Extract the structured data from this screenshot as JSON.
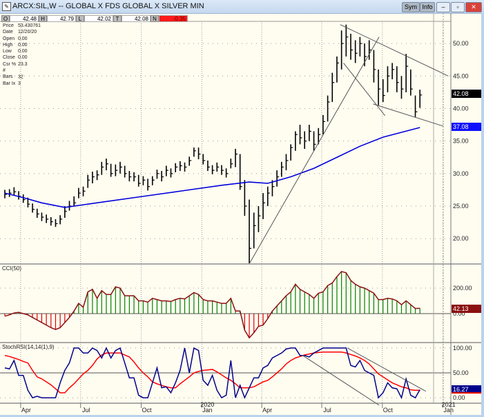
{
  "window": {
    "title": "ARCX:SIL,W -- GLOBAL X FDS GLOBAL X SILVER MIN",
    "buttons": {
      "sym": "Sym",
      "info": "Info",
      "minimize": "–",
      "maximize": "▫",
      "close": "✕"
    }
  },
  "ohlc_strip": {
    "o_label": "O",
    "o_value": "42.48",
    "h_label": "H",
    "h_value": "42.79",
    "l_label": "L",
    "l_value": "42.02",
    "t_label": "T",
    "t_value": "42.08",
    "n_label": "N",
    "n_value": "-0.35"
  },
  "info_box": [
    {
      "label": "Price",
      "value": "53.430761"
    },
    {
      "label": "Date",
      "value": "12/20/20"
    },
    {
      "label": "Open",
      "value": "0.00"
    },
    {
      "label": "High",
      "value": "0.00"
    },
    {
      "label": "Low",
      "value": "0.00"
    },
    {
      "label": "Close",
      "value": "0.00"
    },
    {
      "label": "Csr %",
      "value": "23.3"
    },
    {
      "label": "# Bars",
      "value": "32"
    },
    {
      "label": "Bar Ix",
      "value": "3"
    }
  ],
  "value_tags": {
    "last_price": "42.08",
    "ma_value": "37.08",
    "cci_value": "42.13",
    "stoch_value": "16.27"
  },
  "colors": {
    "background": "#fffcf0",
    "bars": "#000000",
    "moving_average": "#0000dd",
    "cci_positive": "#008000",
    "cci_negative": "#e00000",
    "cci_line": "#8b1010",
    "stoch_k": "#00008b",
    "stoch_d": "#ff0000",
    "trendline": "#555555",
    "change_negative": "#ff1a1a"
  },
  "chart_data": [
    {
      "type": "ohlc",
      "panel": "price",
      "ylim": [
        16.1,
        53.4
      ],
      "y_ticks": [
        "20.00",
        "25.00",
        "30.00",
        "35.00",
        "40.00",
        "45.00",
        "50.00"
      ],
      "grid": true,
      "bars_columns": [
        "date",
        "high",
        "low",
        "close"
      ],
      "bars": [
        [
          "2019-03-08",
          27.5,
          26.2,
          26.8
        ],
        [
          "2019-03-15",
          27.6,
          26.4,
          27
        ],
        [
          "2019-03-22",
          27.9,
          26.6,
          27.2
        ],
        [
          "2019-03-29",
          27.3,
          26,
          26.5
        ],
        [
          "2019-04-05",
          26.8,
          25.5,
          26
        ],
        [
          "2019-04-12",
          26.3,
          24.8,
          25.3
        ],
        [
          "2019-04-19",
          25.4,
          24,
          24.5
        ],
        [
          "2019-04-26",
          24.6,
          23.2,
          23.8
        ],
        [
          "2019-05-03",
          24,
          22.7,
          23.3
        ],
        [
          "2019-05-10",
          23.7,
          22.4,
          23
        ],
        [
          "2019-05-17",
          23.3,
          22,
          22.6
        ],
        [
          "2019-05-24",
          23,
          21.8,
          22.3
        ],
        [
          "2019-05-31",
          23.6,
          22.2,
          23
        ],
        [
          "2019-06-07",
          25,
          23.2,
          24.2
        ],
        [
          "2019-06-14",
          25.8,
          24.3,
          25
        ],
        [
          "2019-06-21",
          26.5,
          25,
          25.5
        ],
        [
          "2019-06-28",
          27.8,
          26.2,
          27
        ],
        [
          "2019-07-05",
          28,
          26.5,
          27.3
        ],
        [
          "2019-07-12",
          29.8,
          27.8,
          29
        ],
        [
          "2019-07-19",
          30.3,
          28.5,
          29.5
        ],
        [
          "2019-07-26",
          30.5,
          29,
          29.8
        ],
        [
          "2019-08-02",
          31.8,
          29.8,
          31
        ],
        [
          "2019-08-09",
          32.3,
          30.5,
          31.5
        ],
        [
          "2019-08-16",
          31.5,
          29.5,
          30
        ],
        [
          "2019-08-23",
          31.4,
          29.6,
          30.5
        ],
        [
          "2019-08-30",
          31.8,
          30,
          31
        ],
        [
          "2019-09-06",
          31.2,
          29.4,
          30
        ],
        [
          "2019-09-13",
          30.4,
          28.8,
          29.5
        ],
        [
          "2019-09-20",
          30.2,
          28.8,
          29.5
        ],
        [
          "2019-09-27",
          29.8,
          28,
          28.5
        ],
        [
          "2019-10-04",
          29.6,
          28.2,
          29
        ],
        [
          "2019-10-11",
          29.2,
          27.4,
          28
        ],
        [
          "2019-10-18",
          29.6,
          28.2,
          29
        ],
        [
          "2019-10-25",
          30.6,
          29.2,
          30
        ],
        [
          "2019-11-01",
          30.4,
          28.8,
          29.5
        ],
        [
          "2019-11-08",
          31.2,
          29.6,
          30.5
        ],
        [
          "2019-11-15",
          30.8,
          29.4,
          30
        ],
        [
          "2019-11-22",
          31.6,
          30.2,
          31
        ],
        [
          "2019-11-29",
          31.9,
          30.4,
          31.2
        ],
        [
          "2019-12-06",
          31.7,
          30.3,
          31
        ],
        [
          "2019-12-13",
          32.6,
          31.2,
          32
        ],
        [
          "2019-12-20",
          34,
          32.6,
          33.5
        ],
        [
          "2019-12-27",
          34,
          32.2,
          33
        ],
        [
          "2020-01-03",
          33,
          31.4,
          32
        ],
        [
          "2020-01-10",
          32,
          30.4,
          31
        ],
        [
          "2020-01-17",
          31.3,
          29.9,
          30.5
        ],
        [
          "2020-01-24",
          31.7,
          30.3,
          31
        ],
        [
          "2020-01-31",
          31.3,
          29.8,
          30.5
        ],
        [
          "2020-02-07",
          30.8,
          29.4,
          30
        ],
        [
          "2020-02-14",
          32.3,
          30.8,
          31.5
        ],
        [
          "2020-02-21",
          33.8,
          31,
          33
        ],
        [
          "2020-02-28",
          33,
          27.5,
          28
        ],
        [
          "2020-03-06",
          29,
          23.5,
          25
        ],
        [
          "2020-03-13",
          26,
          16.2,
          18.5
        ],
        [
          "2020-03-20",
          24,
          18.5,
          22
        ],
        [
          "2020-03-27",
          25,
          21,
          23.5
        ],
        [
          "2020-04-03",
          27,
          23,
          25.5
        ],
        [
          "2020-04-10",
          28,
          25,
          27
        ],
        [
          "2020-04-17",
          29,
          26.5,
          28
        ],
        [
          "2020-04-24",
          30.5,
          28,
          29.5
        ],
        [
          "2020-05-01",
          31.8,
          29.5,
          31
        ],
        [
          "2020-05-08",
          33,
          30.5,
          32
        ],
        [
          "2020-05-15",
          34.5,
          32,
          34
        ],
        [
          "2020-05-22",
          36.5,
          33.5,
          36
        ],
        [
          "2020-05-29",
          37.5,
          34.5,
          35.5
        ],
        [
          "2020-06-05",
          36.5,
          33.8,
          35
        ],
        [
          "2020-06-12",
          37.5,
          35,
          36.5
        ],
        [
          "2020-06-19",
          36.5,
          33.5,
          34.5
        ],
        [
          "2020-06-26",
          37,
          34.5,
          36
        ],
        [
          "2020-07-03",
          39,
          36,
          38
        ],
        [
          "2020-07-10",
          42,
          38,
          41
        ],
        [
          "2020-07-17",
          45.5,
          41,
          44
        ],
        [
          "2020-07-24",
          48,
          44,
          47
        ],
        [
          "2020-07-31",
          52,
          46,
          50
        ],
        [
          "2020-08-07",
          52.9,
          48,
          51
        ],
        [
          "2020-08-14",
          51.5,
          47.5,
          49
        ],
        [
          "2020-08-21",
          50.5,
          47,
          48.5
        ],
        [
          "2020-08-28",
          51,
          48,
          50
        ],
        [
          "2020-09-04",
          50,
          46.5,
          48
        ],
        [
          "2020-09-11",
          50.5,
          47.5,
          49
        ],
        [
          "2020-09-18",
          49,
          44,
          46
        ],
        [
          "2020-09-25",
          46,
          40.5,
          43
        ],
        [
          "2020-10-02",
          44.5,
          41,
          42
        ],
        [
          "2020-10-09",
          46.5,
          42.5,
          45
        ],
        [
          "2020-10-16",
          47,
          44.5,
          46
        ],
        [
          "2020-10-23",
          46.5,
          42.5,
          44
        ],
        [
          "2020-10-30",
          45,
          41.5,
          43
        ],
        [
          "2020-11-06",
          48.4,
          42.5,
          46.5
        ],
        [
          "2020-11-13",
          46,
          42,
          43
        ],
        [
          "2020-11-20",
          42,
          38.7,
          39.5
        ],
        [
          "2020-11-27",
          42.9,
          40.1,
          42.08
        ]
      ],
      "moving_average": [
        [
          "2019-03-08",
          27
        ],
        [
          "2019-04-05",
          26.3
        ],
        [
          "2019-05-03",
          25.5
        ],
        [
          "2019-06-07",
          24.8
        ],
        [
          "2019-07-05",
          25.2
        ],
        [
          "2019-08-02",
          25.6
        ],
        [
          "2019-10-04",
          26.5
        ],
        [
          "2019-12-06",
          27.4
        ],
        [
          "2020-01-31",
          28.2
        ],
        [
          "2020-03-13",
          28.7
        ],
        [
          "2020-04-10",
          28.5
        ],
        [
          "2020-05-15",
          29.5
        ],
        [
          "2020-06-19",
          30.8
        ],
        [
          "2020-07-24",
          32.5
        ],
        [
          "2020-08-28",
          34.2
        ],
        [
          "2020-10-02",
          35.6
        ],
        [
          "2020-11-27",
          37.08
        ]
      ],
      "trendlines": [
        [
          [
            "2020-03-14",
            16.3
          ],
          [
            "2020-09-26",
            51
          ]
        ],
        [
          [
            "2020-07-29",
            52.9
          ],
          [
            "2021-01-09",
            45
          ]
        ],
        [
          [
            "2020-08-03",
            47
          ],
          [
            "2020-10-05",
            38.9
          ]
        ],
        [
          [
            "2020-09-17",
            40.7
          ],
          [
            "2021-01-01",
            37.3
          ]
        ]
      ]
    },
    {
      "type": "histogram",
      "panel": "cci",
      "label": "CCI(50)",
      "ylim": [
        -227,
        389
      ],
      "y_ticks": [
        "0.00",
        "200.00"
      ],
      "values": [
        -20,
        -10,
        5,
        10,
        0,
        -10,
        -30,
        -50,
        -70,
        -90,
        -110,
        -125,
        -110,
        -70,
        -30,
        20,
        80,
        50,
        170,
        190,
        120,
        180,
        150,
        150,
        210,
        200,
        140,
        140,
        140,
        100,
        100,
        90,
        120,
        110,
        100,
        100,
        95,
        110,
        120,
        115,
        140,
        165,
        150,
        110,
        100,
        100,
        90,
        80,
        80,
        120,
        20,
        20,
        -130,
        -190,
        -150,
        -100,
        -90,
        -40,
        20,
        60,
        100,
        140,
        170,
        230,
        190,
        170,
        150,
        120,
        160,
        170,
        220,
        240,
        290,
        330,
        320,
        260,
        230,
        210,
        200,
        180,
        160,
        110,
        110,
        120,
        115,
        100,
        70,
        100,
        70,
        40,
        42.13
      ]
    },
    {
      "type": "line",
      "panel": "stochrsi",
      "label": "StochRSI(14,14(1),9)",
      "ylim": [
        -11,
        111
      ],
      "y_ticks": [
        "0.00",
        "50.00",
        "100.00"
      ],
      "series": [
        {
          "values": [
            60,
            58,
            75,
            45,
            45,
            15,
            0,
            3,
            0,
            0,
            0,
            0,
            30,
            55,
            70,
            100,
            100,
            90,
            90,
            100,
            95,
            80,
            100,
            80,
            95,
            100,
            70,
            40,
            40,
            5,
            0,
            0,
            30,
            60,
            20,
            22,
            10,
            30,
            55,
            100,
            50,
            100,
            95,
            35,
            25,
            45,
            15,
            0,
            5,
            75,
            0,
            25,
            0,
            20,
            40,
            40,
            60,
            65,
            80,
            85,
            90,
            98,
            100,
            100,
            85,
            85,
            82,
            90,
            95,
            100,
            100,
            100,
            100,
            100,
            100,
            65,
            62,
            75,
            55,
            50,
            45,
            0,
            10,
            30,
            20,
            18,
            0,
            38,
            5,
            0,
            16.27
          ]
        },
        {
          "values": [
            85,
            83,
            80,
            77,
            73,
            70,
            55,
            42,
            38,
            32,
            26,
            18,
            10,
            10,
            20,
            28,
            38,
            48,
            55,
            65,
            78,
            86,
            90,
            90,
            90,
            90,
            86,
            82,
            72,
            60,
            50,
            42,
            32,
            28,
            25,
            22,
            20,
            20,
            28,
            35,
            42,
            50,
            53,
            55,
            56,
            57,
            52,
            46,
            40,
            35,
            28,
            20,
            20,
            20,
            22,
            27,
            32,
            35,
            42,
            50,
            58,
            68,
            75,
            80,
            83,
            86,
            88,
            90,
            91,
            92,
            92,
            92,
            92,
            92,
            90,
            87,
            84,
            80,
            75,
            68,
            58,
            48,
            42,
            36,
            30,
            26,
            22,
            20,
            16,
            15,
            15
          ]
        }
      ],
      "trendlines": [
        [
          [
            "2020-06-01",
            86
          ],
          [
            "2020-09-26",
            -15
          ]
        ],
        [
          [
            "2020-08-09",
            100
          ],
          [
            "2020-12-06",
            13
          ]
        ]
      ]
    }
  ],
  "x_axis": {
    "ticks": [
      {
        "label": "Apr",
        "date": "2019-04-01",
        "year": ""
      },
      {
        "label": "Jul",
        "date": "2019-07-01",
        "year": ""
      },
      {
        "label": "Oct",
        "date": "2019-10-01",
        "year": ""
      },
      {
        "label": "Jan",
        "date": "2020-01-01",
        "year": "2020"
      },
      {
        "label": "Apr",
        "date": "2020-04-01",
        "year": ""
      },
      {
        "label": "Jul",
        "date": "2020-07-01",
        "year": ""
      },
      {
        "label": "Oct",
        "date": "2020-10-01",
        "year": ""
      },
      {
        "label": "Jan",
        "date": "2021-01-01",
        "year": "2021"
      }
    ]
  }
}
